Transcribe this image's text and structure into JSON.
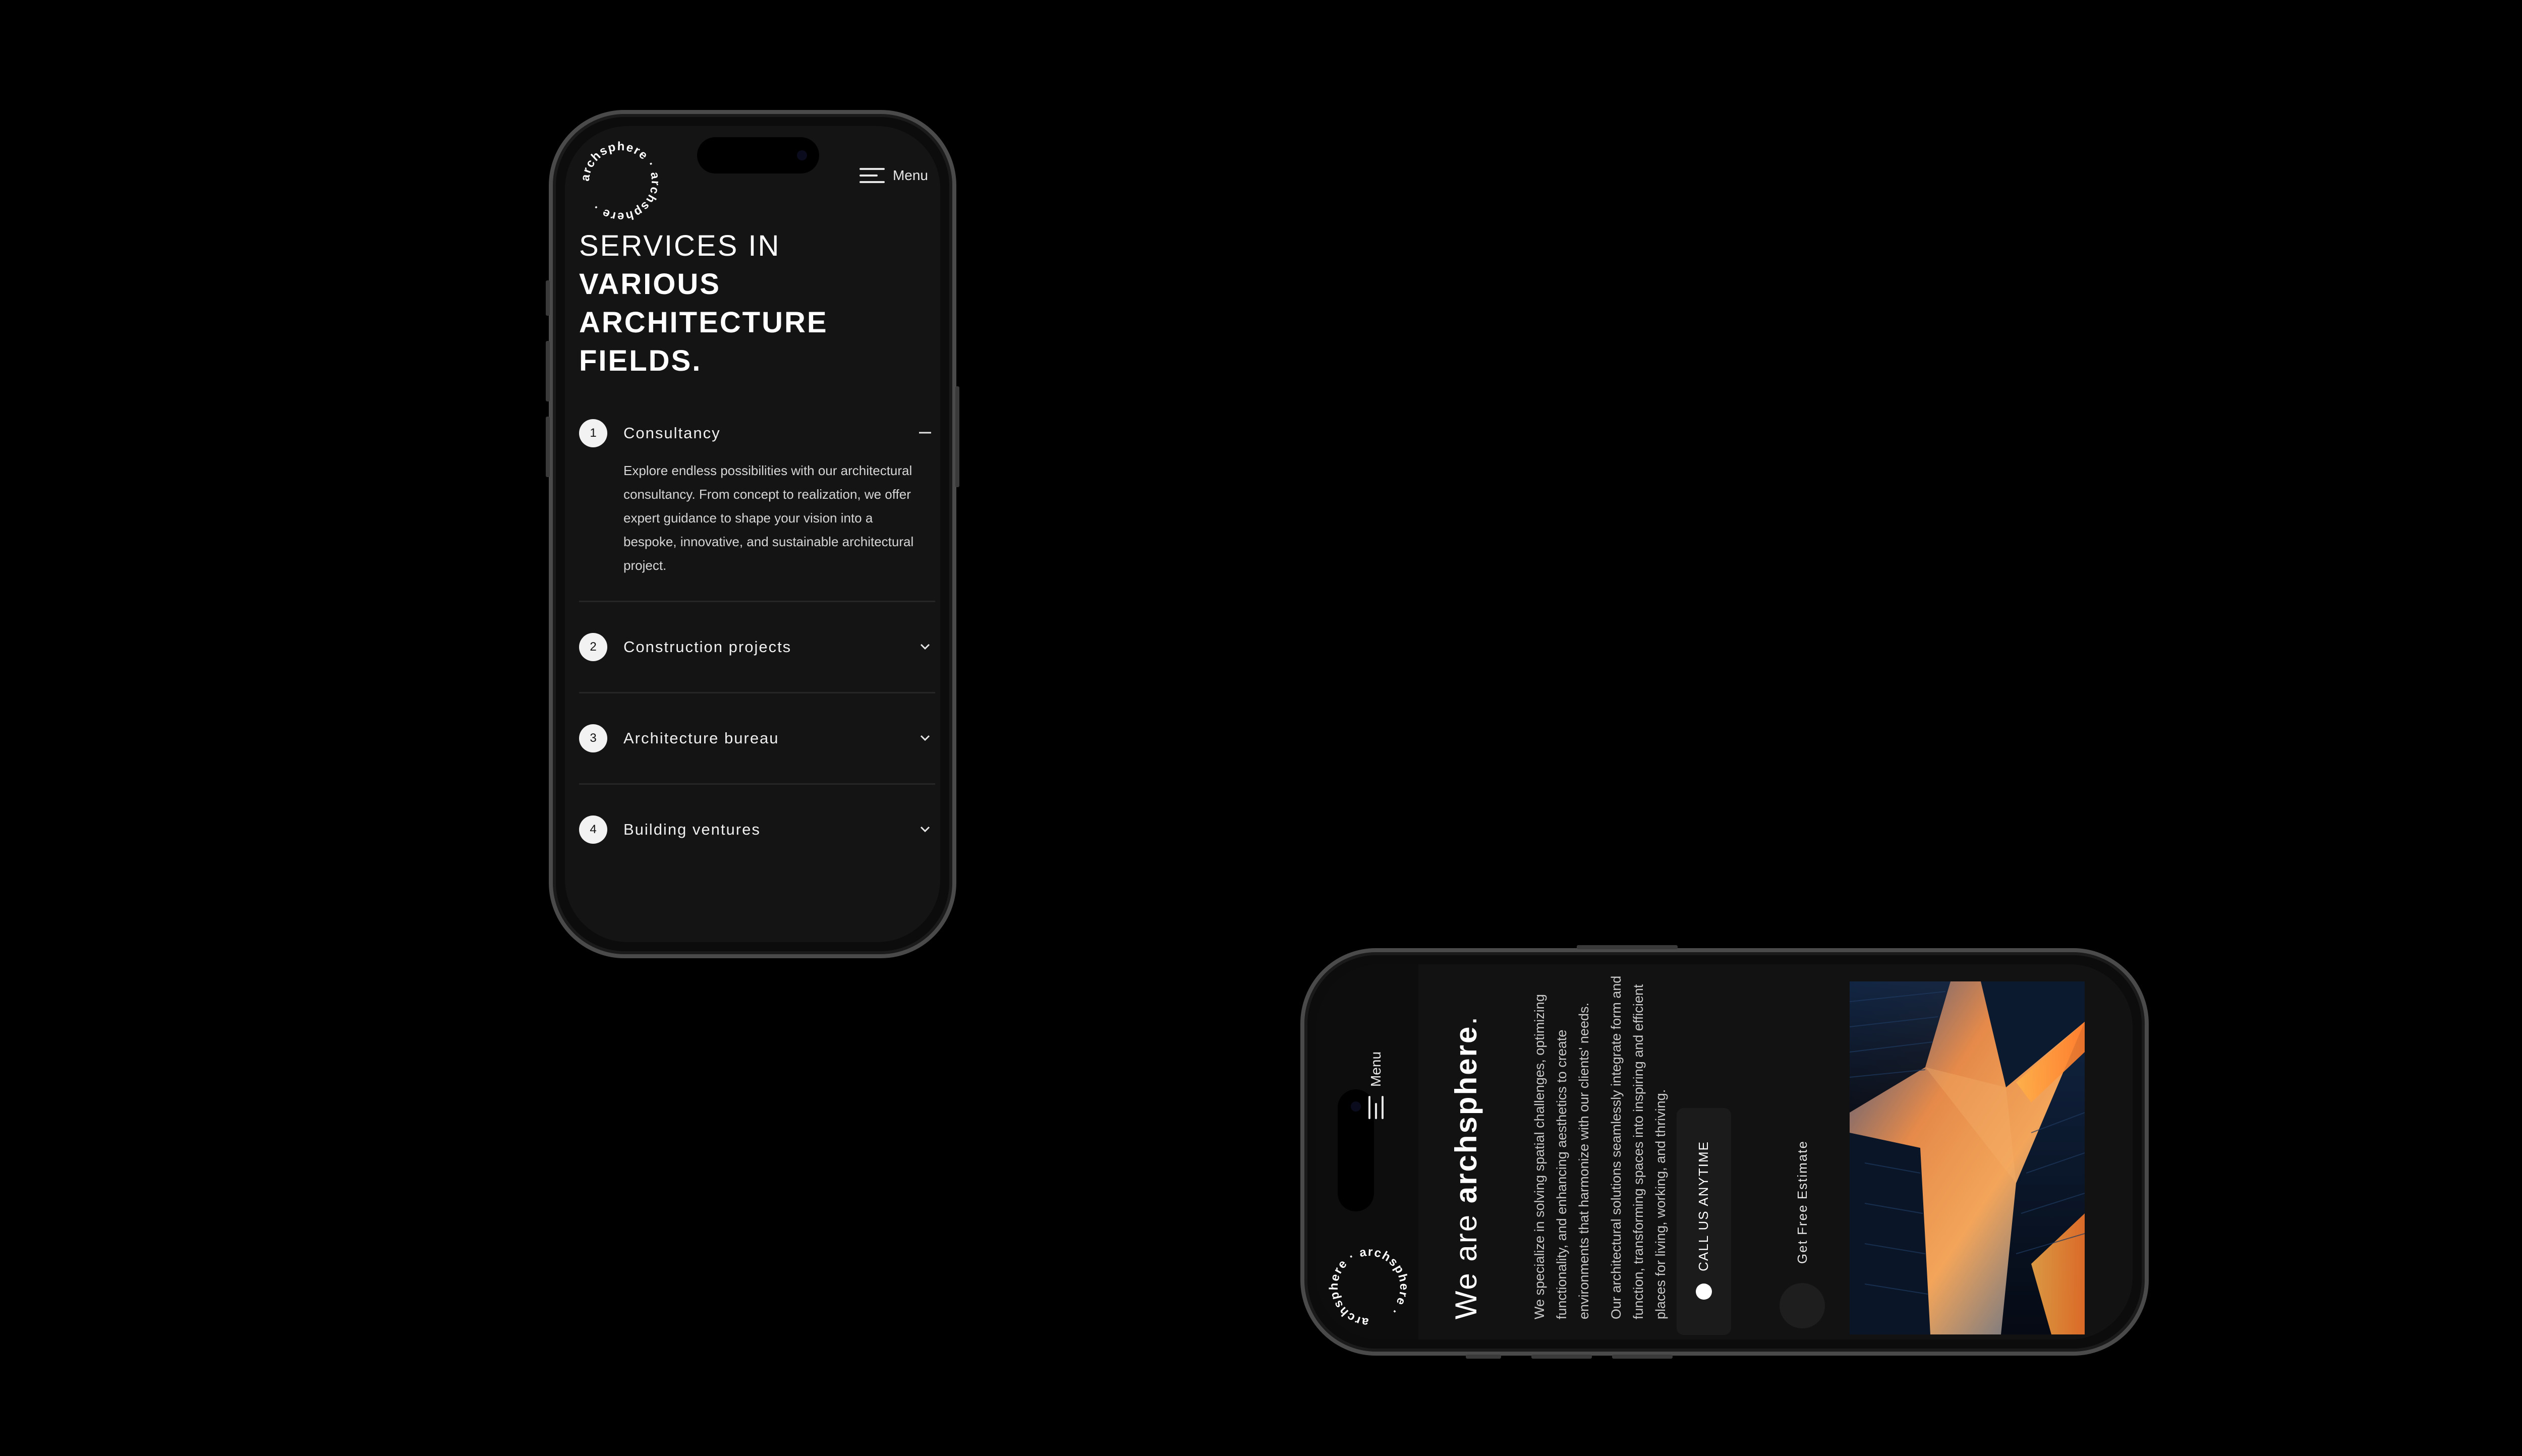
{
  "brand": {
    "logo_text": "archsphere · archsphere ·"
  },
  "portrait": {
    "menu_label": "Menu",
    "headline_light": "SERVICES IN",
    "headline_bold_1": "VARIOUS",
    "headline_bold_2": "ARCHITECTURE",
    "headline_bold_3": "FIELDS.",
    "services": [
      {
        "number": "1",
        "title": "Consultancy",
        "expanded": true,
        "description": "Explore endless possibilities with our architectural consultancy. From concept to realization, we offer expert guidance to shape your vision into a bespoke, innovative, and sustainable architectural project.",
        "toggle_icon": "minus-icon"
      },
      {
        "number": "2",
        "title": "Construction projects",
        "expanded": false,
        "toggle_icon": "chevron-down-icon"
      },
      {
        "number": "3",
        "title": "Architecture bureau",
        "expanded": false,
        "toggle_icon": "chevron-down-icon"
      },
      {
        "number": "4",
        "title": "Building ventures",
        "expanded": false,
        "toggle_icon": "chevron-down-icon"
      }
    ]
  },
  "landscape": {
    "menu_label": "Menu",
    "title_prefix": "We are ",
    "title_brand": "archsphere",
    "title_suffix": ".",
    "paragraph_1": "We specialize in solving spatial challenges, optimizing functionality, and enhancing aesthetics to create environments that harmonize with our clients' needs.",
    "paragraph_2": "Our architectural solutions seamlessly integrate form and function, transforming spaces into inspiring and efficient places for living, working, and thriving.",
    "call_label": "CALL US ANYTIME",
    "estimate_label": "Get Free Estimate"
  },
  "colors": {
    "background": "#000000",
    "screen": "#141414",
    "accent_orange": "#f08a3c",
    "sky_blue": "#3b6fb0"
  }
}
